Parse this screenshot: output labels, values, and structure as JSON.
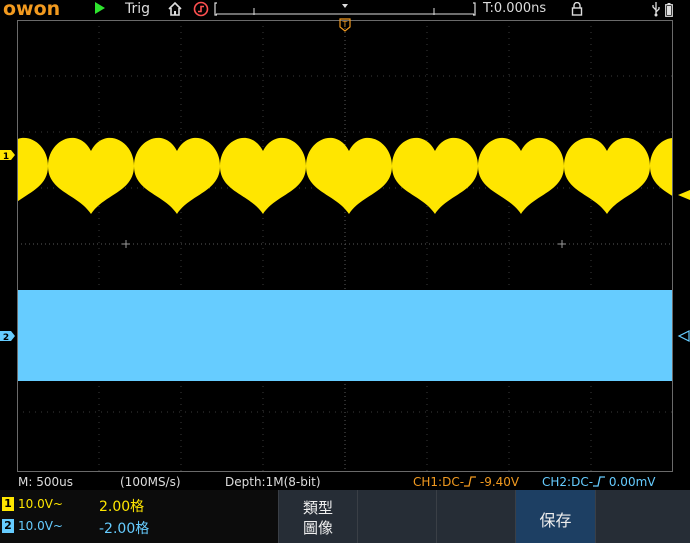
{
  "topbar": {
    "brand": "owon",
    "trigger_label": "Trig",
    "time_offset": "T:0.000ns",
    "colors": {
      "brand": "#f29a1f",
      "run": "#2ee52e"
    },
    "icons": [
      "run-icon",
      "home-icon",
      "trigger-icon",
      "lock-icon",
      "usb-icon",
      "battery-icon"
    ]
  },
  "markers": {
    "trigger_top": "T",
    "ch1": "1",
    "ch2": "2"
  },
  "channels": [
    {
      "id": "1",
      "color": "#ffe600",
      "signal": "heart-shaped periodic pattern"
    },
    {
      "id": "2",
      "color": "#66ccff",
      "signal": "filled band"
    }
  ],
  "status": {
    "timebase": "M: 500us",
    "sample_rate": "(100MS/s)",
    "depth": "Depth:1M(8-bit)",
    "ch1": "CH1:DC-",
    "ch1_level": "-9.40V",
    "ch2": "CH2:DC-",
    "ch2_level": "0.00mV"
  },
  "bottom": {
    "ch1": {
      "num": "1",
      "scale": "10.0V~",
      "pos": "2.00格"
    },
    "ch2": {
      "num": "2",
      "scale": "10.0V~",
      "pos": "-2.00格"
    },
    "menu": [
      {
        "line1": "類型",
        "line2": "圖像"
      },
      {
        "line1": "",
        "line2": ""
      },
      {
        "line1": "",
        "line2": ""
      },
      {
        "line1": "保存",
        "line2": ""
      },
      {
        "line1": "",
        "line2": ""
      }
    ]
  }
}
